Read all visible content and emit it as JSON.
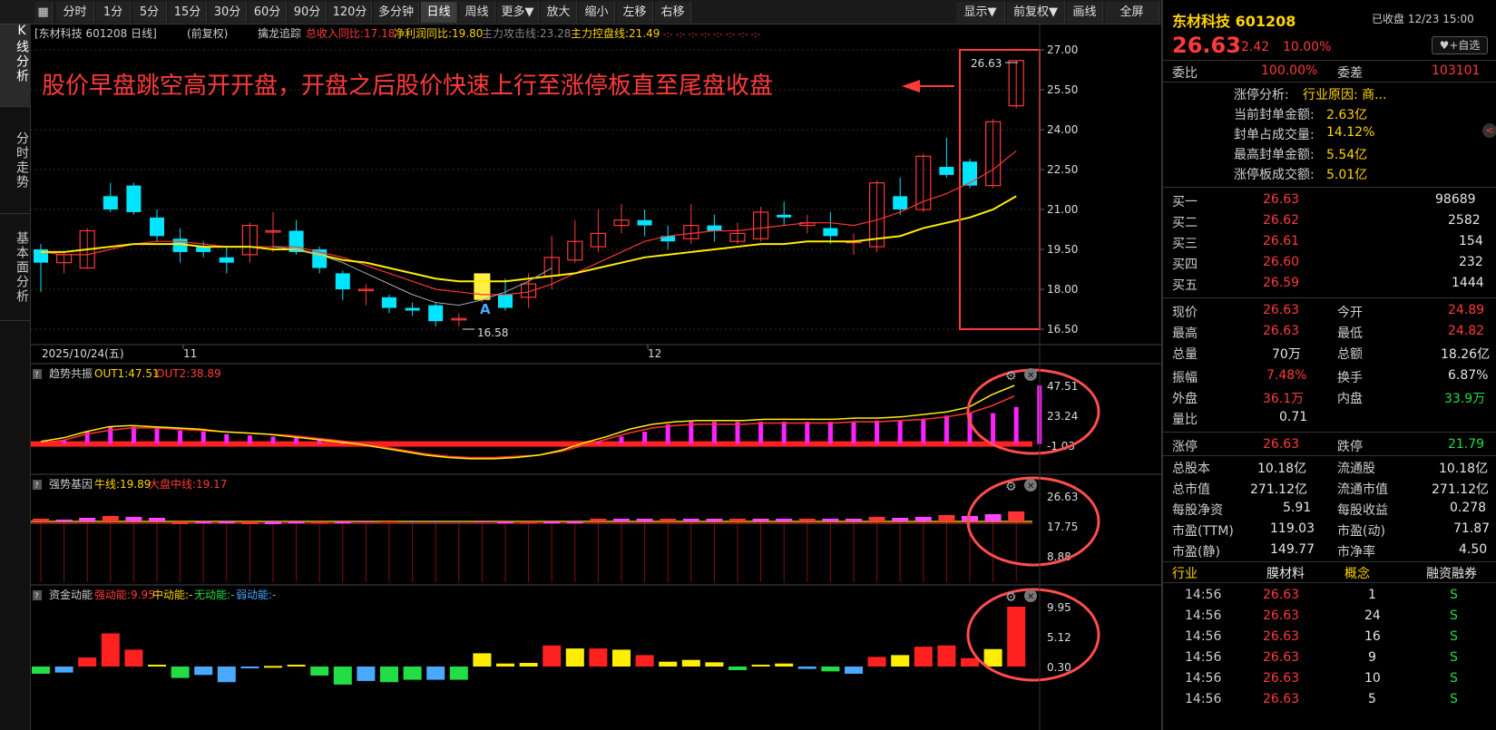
{
  "toolbar": {
    "periods": [
      "分时",
      "1分",
      "5分",
      "15分",
      "30分",
      "60分",
      "90分",
      "120分",
      "多分钟",
      "日线",
      "周线",
      "更多▼",
      "放大",
      "缩小",
      "左移",
      "右移"
    ],
    "right": [
      "显示▼",
      "前复权▼",
      "画线",
      "全屏"
    ]
  },
  "side_tabs": [
    "K线分析",
    "分时走势",
    "基本面分析"
  ],
  "main": {
    "header": {
      "name": "[东材科技 601208 日线]",
      "adj": "(前复权)",
      "ind": "擒龙追踪",
      "f1": "总收入同比:17.18",
      "f2": "净利润同比:19.80",
      "f3": "主力攻击线:23.28",
      "f4": "主力控盘线:21.49",
      "markers": "-:- -:- -:- -:- -:- -:- -:- -:-"
    },
    "annotation": "股价早盘跳空高开开盘，开盘之后股价快速上行至涨停板直至尾盘收盘",
    "price_labels": {
      "high": "26.63",
      "low": "16.58",
      "marker": "A"
    },
    "date_axis": {
      "start": "2025/10/24(五)",
      "m1": "11",
      "m2": "12"
    },
    "price_axis": [
      "27.00",
      "25.50",
      "24.00",
      "22.50",
      "21.00",
      "19.50",
      "18.00",
      "16.50"
    ],
    "panels": [
      {
        "name": "趋势共振",
        "l1": "OUT1:47.51",
        "l2": "OUT2:38.89",
        "axis": [
          "47.51",
          "23.24",
          "-1.03"
        ]
      },
      {
        "name": "强势基因",
        "l1": "牛线:19.89",
        "l2": "大盘中线:19.17",
        "axis": [
          "26.63",
          "17.75",
          "8.88"
        ]
      },
      {
        "name": "资金动能",
        "l1": "强动能:9.95",
        "l2": "中动能:-",
        "l3": "无动能:-",
        "l4": "弱动能:-",
        "axis": [
          "9.95",
          "5.12",
          "0.30"
        ]
      }
    ]
  },
  "chart_data": [
    {
      "type": "candlestick",
      "title": "东材科技 601208 日线",
      "y_axis": [
        16.5,
        27.0
      ],
      "candles": [
        [
          19.5,
          19.0,
          19.7,
          17.9
        ],
        [
          19.0,
          19.3,
          19.4,
          18.6
        ],
        [
          18.8,
          20.2,
          20.3,
          18.8
        ],
        [
          21.5,
          21.0,
          22.0,
          20.9
        ],
        [
          21.9,
          20.9,
          22.0,
          20.8
        ],
        [
          20.7,
          20.0,
          21.0,
          19.8
        ],
        [
          19.9,
          19.4,
          20.3,
          19.0
        ],
        [
          19.6,
          19.4,
          19.8,
          19.2
        ],
        [
          19.2,
          19.0,
          19.6,
          18.6
        ],
        [
          19.3,
          20.4,
          20.5,
          19.0
        ],
        [
          20.2,
          20.2,
          20.9,
          19.4
        ],
        [
          20.2,
          19.4,
          20.6,
          19.3
        ],
        [
          19.5,
          18.8,
          19.6,
          18.6
        ],
        [
          18.6,
          18.0,
          18.7,
          17.6
        ],
        [
          18.0,
          18.0,
          18.2,
          17.4
        ],
        [
          17.7,
          17.3,
          17.8,
          17.1
        ],
        [
          17.3,
          17.2,
          17.5,
          17.0
        ],
        [
          17.4,
          16.8,
          17.5,
          16.6
        ],
        [
          16.9,
          16.9,
          17.1,
          16.6
        ],
        [
          17.9,
          18.0,
          18.6,
          17.5
        ],
        [
          17.8,
          17.3,
          18.4,
          17.2
        ],
        [
          17.7,
          18.2,
          18.6,
          17.3
        ],
        [
          18.5,
          19.2,
          20.0,
          18.0
        ],
        [
          19.1,
          19.8,
          20.6,
          19.0
        ],
        [
          19.6,
          20.1,
          21.0,
          19.4
        ],
        [
          20.4,
          20.6,
          21.2,
          20.1
        ],
        [
          20.6,
          20.4,
          21.0,
          20.0
        ],
        [
          20.0,
          19.8,
          20.4,
          19.5
        ],
        [
          19.9,
          20.4,
          21.2,
          19.7
        ],
        [
          20.4,
          20.2,
          20.8,
          19.8
        ],
        [
          19.8,
          20.1,
          20.5,
          19.7
        ],
        [
          19.9,
          20.9,
          21.1,
          19.8
        ],
        [
          20.8,
          20.7,
          21.3,
          20.4
        ],
        [
          20.4,
          20.5,
          20.8,
          20.1
        ],
        [
          20.3,
          20.0,
          20.9,
          19.7
        ],
        [
          19.8,
          19.8,
          20.1,
          19.3
        ],
        [
          19.6,
          22.0,
          22.1,
          19.4
        ],
        [
          21.5,
          21.0,
          22.2,
          20.8
        ],
        [
          21.0,
          23.0,
          23.1,
          20.9
        ],
        [
          22.6,
          22.3,
          23.7,
          22.2
        ],
        [
          22.8,
          21.9,
          22.9,
          21.8
        ],
        [
          21.9,
          24.3,
          24.4,
          21.8
        ],
        [
          24.9,
          26.6,
          26.6,
          24.8
        ]
      ],
      "ma": [
        [
          19.4,
          19.3,
          19.3,
          19.5,
          19.7,
          19.8,
          19.8,
          19.7,
          19.6,
          19.6,
          19.6,
          19.6,
          19.4,
          19.2,
          18.9,
          18.6,
          18.3,
          18.0,
          17.9,
          17.8,
          17.8,
          17.9,
          18.2,
          18.6,
          19.0,
          19.4,
          19.8,
          20.0,
          20.1,
          20.2,
          20.2,
          20.3,
          20.4,
          20.5,
          20.5,
          20.4,
          20.6,
          20.9,
          21.3,
          21.6,
          22.0,
          22.5,
          23.2
        ],
        [
          19.4,
          19.4,
          19.5,
          19.6,
          19.7,
          19.7,
          19.7,
          19.6,
          19.6,
          19.6,
          19.5,
          19.5,
          19.3,
          19.1,
          19.0,
          18.8,
          18.6,
          18.4,
          18.3,
          18.3,
          18.3,
          18.4,
          18.5,
          18.6,
          18.8,
          19.0,
          19.2,
          19.3,
          19.4,
          19.5,
          19.6,
          19.7,
          19.7,
          19.8,
          19.8,
          19.8,
          19.9,
          20.0,
          20.3,
          20.5,
          20.7,
          21.0,
          21.5
        ]
      ]
    },
    {
      "type": "line",
      "name": "趋势共振",
      "y_axis": [
        -1.03,
        47.51
      ],
      "out1": [
        2,
        5,
        10,
        14,
        15,
        14,
        13,
        12,
        10,
        9,
        8,
        6,
        4,
        2,
        0,
        -3,
        -6,
        -9,
        -11,
        -12,
        -12,
        -11,
        -9,
        -5,
        1,
        6,
        12,
        16,
        18,
        19,
        19,
        19,
        20,
        20,
        20,
        20,
        21,
        21,
        22,
        24,
        26,
        30,
        40,
        47.51
      ],
      "out2": [
        1,
        3,
        8,
        11,
        13,
        13,
        12,
        11,
        10,
        9,
        8,
        7,
        5,
        3,
        1,
        -2,
        -5,
        -8,
        -10,
        -11,
        -11,
        -10,
        -9,
        -6,
        -1,
        4,
        9,
        13,
        15,
        16,
        16,
        16,
        17,
        17,
        17,
        17,
        18,
        18,
        19,
        20,
        22,
        25,
        31,
        38.89
      ],
      "bars": [
        0,
        3,
        10,
        14,
        14,
        13,
        11,
        10,
        8,
        7,
        6,
        5,
        3,
        2,
        0,
        0,
        0,
        0,
        0,
        0,
        0,
        0,
        0,
        0,
        2,
        6,
        10,
        16,
        18,
        18,
        18,
        18,
        18,
        18,
        18,
        18,
        19,
        19,
        20,
        23,
        25,
        25,
        30,
        47.51
      ]
    },
    {
      "type": "bar",
      "name": "强势基因",
      "y_axis": [
        8.88,
        26.63
      ]
    },
    {
      "type": "bar",
      "name": "资金动能",
      "y_axis": [
        0.3,
        9.95
      ],
      "values": [
        -1.2,
        -1.0,
        1.5,
        5.5,
        2.8,
        0.3,
        -1.9,
        -1.4,
        -2.6,
        -0.2,
        0.1,
        0.3,
        -1.5,
        -3.0,
        -2.4,
        -2.6,
        -2.2,
        -2.2,
        -2.2,
        2.2,
        0.5,
        0.6,
        3.5,
        3.0,
        3.0,
        2.8,
        1.9,
        0.8,
        1.1,
        0.7,
        -0.6,
        0.3,
        0.5,
        -0.4,
        -0.8,
        -1.2,
        1.6,
        1.9,
        3.3,
        3.5,
        1.4,
        2.9,
        9.95
      ]
    }
  ],
  "quote": {
    "title": "东材科技 601208",
    "status": "已收盘 12/23 15:00",
    "price": "26.63",
    "change": "2.42",
    "pct": "10.00%",
    "add_watch": "+自选",
    "wb": "委比",
    "wb_val": "100.00%",
    "wc": "委差",
    "wc_val": "103101",
    "limit": [
      {
        "k": "涨停分析:",
        "v": "行业原因: 商..."
      },
      {
        "k": "当前封单金额:",
        "v": "2.63亿"
      },
      {
        "k": "封单占成交量:",
        "v": "14.12%"
      },
      {
        "k": "最高封单金额:",
        "v": "5.54亿"
      },
      {
        "k": "涨停板成交额:",
        "v": "5.01亿"
      }
    ],
    "bids": [
      {
        "k": "买一",
        "p": "26.63",
        "v": "98689"
      },
      {
        "k": "买二",
        "p": "26.62",
        "v": "2582"
      },
      {
        "k": "买三",
        "p": "26.61",
        "v": "154"
      },
      {
        "k": "买四",
        "p": "26.60",
        "v": "232"
      },
      {
        "k": "买五",
        "p": "26.59",
        "v": "1444"
      }
    ],
    "stats": [
      [
        "现价",
        "26.63",
        "今开",
        "24.89"
      ],
      [
        "最高",
        "26.63",
        "最低",
        "24.82"
      ],
      [
        "总量",
        "70万",
        "总额",
        "18.26亿"
      ],
      [
        "振幅",
        "7.48%",
        "换手",
        "6.87%"
      ],
      [
        "外盘",
        "36.1万",
        "内盘",
        "33.9万"
      ],
      [
        "量比",
        "0.71",
        "",
        ""
      ]
    ],
    "zt": {
      "a": "涨停",
      "av": "26.63",
      "b": "跌停",
      "bv": "21.79"
    },
    "fund": [
      [
        "总股本",
        "10.18亿",
        "流通股",
        "10.18亿"
      ],
      [
        "总市值",
        "271.12亿",
        "流通市值",
        "271.12亿"
      ],
      [
        "每股净资",
        "5.91",
        "每股收益",
        "0.278"
      ],
      [
        "市盈(TTM)",
        "119.03",
        "市盈(动)",
        "71.87"
      ],
      [
        "市盈(静)",
        "149.77",
        "市净率",
        "4.50"
      ]
    ],
    "tags": [
      "行业",
      "膜材料",
      "概念",
      "融资融券"
    ],
    "ticks": [
      [
        "14:56",
        "26.63",
        "1",
        "S"
      ],
      [
        "14:56",
        "26.63",
        "24",
        "S"
      ],
      [
        "14:56",
        "26.63",
        "16",
        "S"
      ],
      [
        "14:56",
        "26.63",
        "9",
        "S"
      ],
      [
        "14:56",
        "26.63",
        "10",
        "S"
      ],
      [
        "14:56",
        "26.63",
        "5",
        "S"
      ]
    ],
    "colors": {
      "up": "#ff3a3a",
      "down": "#00e5ff",
      "ma1": "#ffee00",
      "ma2": "#ff3333",
      "grid": "#2a2a2a"
    }
  }
}
